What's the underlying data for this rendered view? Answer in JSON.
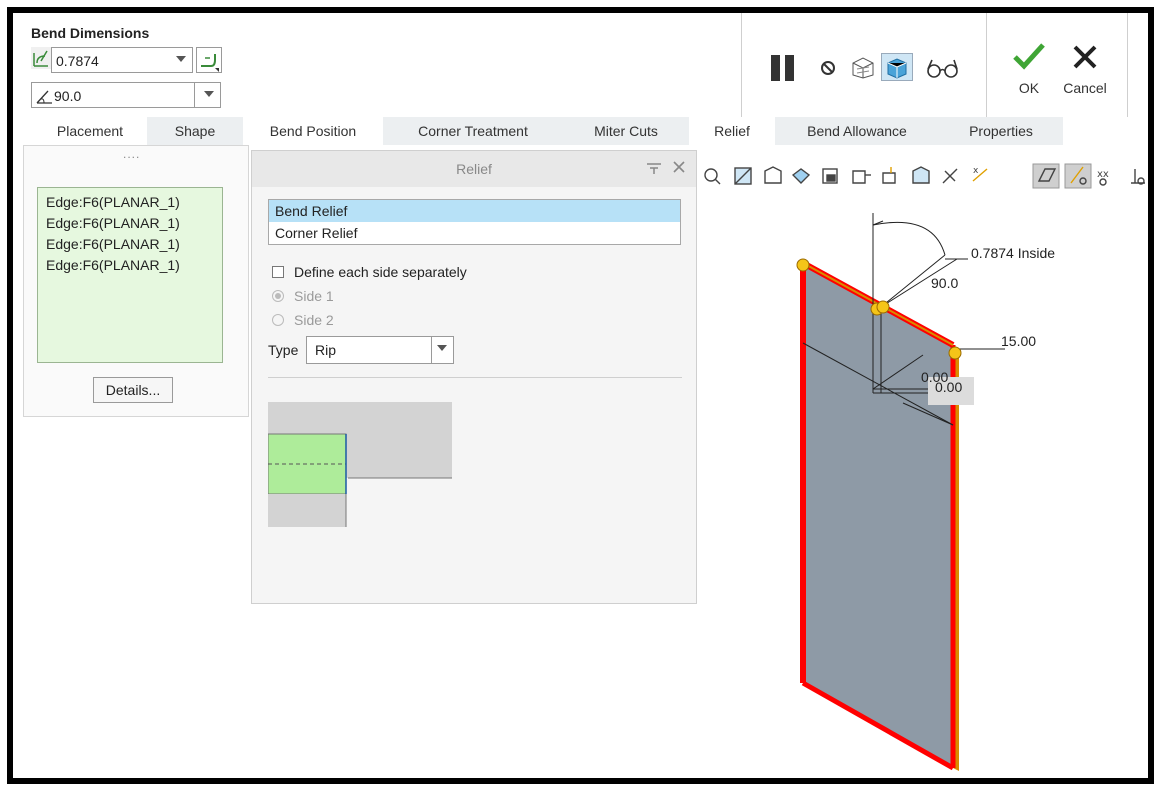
{
  "header": {
    "title": "Bend Dimensions",
    "radius_value": "0.7874",
    "angle_value": "90.0"
  },
  "actions": {
    "ok_label": "OK",
    "cancel_label": "Cancel"
  },
  "tabs": [
    "Placement",
    "Shape",
    "Bend Position",
    "Corner Treatment",
    "Miter Cuts",
    "Relief",
    "Bend Allowance",
    "Properties"
  ],
  "placement": {
    "drag_handle": "....",
    "references": [
      "Edge:F6(PLANAR_1)",
      "Edge:F6(PLANAR_1)",
      "Edge:F6(PLANAR_1)",
      "Edge:F6(PLANAR_1)"
    ],
    "details_label": "Details..."
  },
  "relief_panel": {
    "title": "Relief",
    "list_items": [
      "Bend Relief",
      "Corner Relief"
    ],
    "selected_item": "Bend Relief",
    "define_each_side_label": "Define each side separately",
    "define_each_side_checked": false,
    "side1_label": "Side 1",
    "side2_label": "Side 2",
    "type_label": "Type",
    "type_value": "Rip"
  },
  "model_annotations": {
    "radius_annotation": "0.7874 Inside",
    "angle_annotation": "90.0",
    "length_annotation": "15.00",
    "offset_a": "0.00",
    "offset_b": "0.00"
  },
  "colors": {
    "panel_bg": "#f5f5f5",
    "selected_row": "#b7e1f7",
    "reference_list_bg": "#e6f8df",
    "edge_highlight": "#ff0000",
    "surface": "#8e9aa6",
    "point": "#f5c518",
    "ok_check": "#3fa535"
  },
  "icons": [
    "pause-icon",
    "stop-icon",
    "preview-frame-icon",
    "preview-solid-icon",
    "glasses-icon",
    "check-icon",
    "close-icon"
  ]
}
